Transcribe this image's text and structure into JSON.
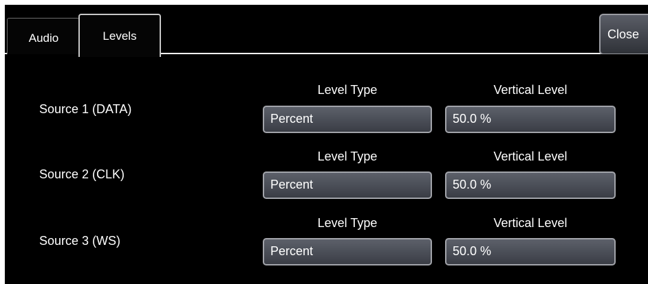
{
  "tabs": [
    {
      "label": "Audio",
      "active": false
    },
    {
      "label": "Levels",
      "active": true
    }
  ],
  "close_label": "Close",
  "sources": [
    {
      "label": "Source 1 (DATA)",
      "level_type_header": "Level Type",
      "vertical_level_header": "Vertical Level",
      "level_type": "Percent",
      "vertical_level": "50.0 %"
    },
    {
      "label": "Source 2 (CLK)",
      "level_type_header": "Level Type",
      "vertical_level_header": "Vertical Level",
      "level_type": "Percent",
      "vertical_level": "50.0 %"
    },
    {
      "label": "Source 3 (WS)",
      "level_type_header": "Level Type",
      "vertical_level_header": "Vertical Level",
      "level_type": "Percent",
      "vertical_level": "50.0 %"
    }
  ],
  "colors": {
    "background": "#000000",
    "text": "#ffffff",
    "field": "#4a4d55",
    "border": "#a2a4aa"
  }
}
